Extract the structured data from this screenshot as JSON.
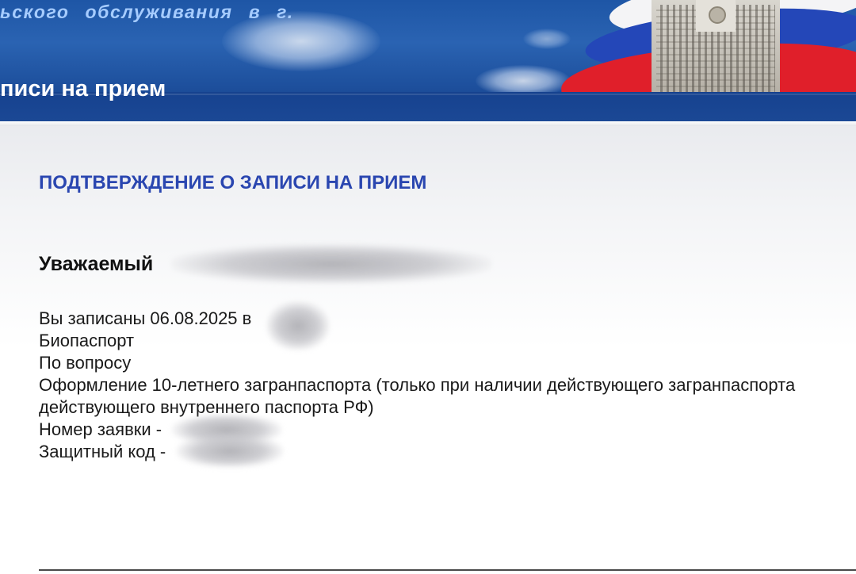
{
  "header": {
    "subtitle": "ьского обслуживания в г.",
    "title": "писи на прием"
  },
  "confirmation": {
    "heading": "ПОДТВЕРЖДЕНИЕ О ЗАПИСИ НА ПРИЕМ",
    "greeting": "Уважаемый",
    "lines": [
      "Вы записаны 06.08.2025 в",
      "Биопаспорт",
      "По вопросу",
      "Оформление 10-летнего загранпаспорта (только при наличии действующего загранпаспорта",
      "действующего внутреннего паспорта РФ)",
      "Номер заявки -",
      "Защитный код -"
    ]
  },
  "colors": {
    "banner_blue": "#1e56a6",
    "heading_blue": "#2a46b0",
    "flag_red": "#e01f2a",
    "flag_blue": "#2447b8"
  }
}
